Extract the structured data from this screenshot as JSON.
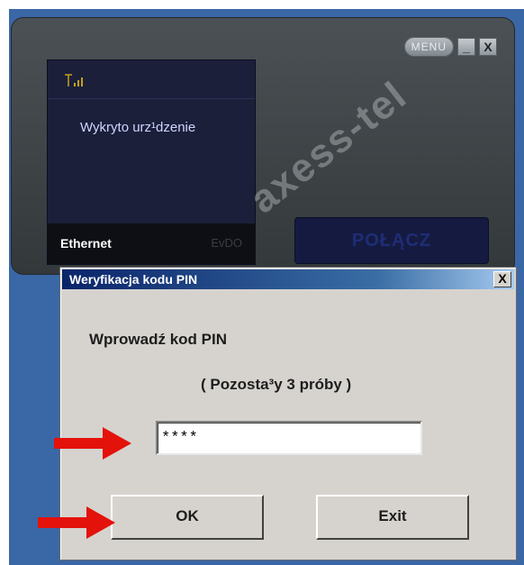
{
  "app": {
    "menu_label": "MENU",
    "minimize_label": "_",
    "close_label": "X",
    "signal_icon": "signal-bars-icon",
    "status_text": "Wykryto urz¹dzenie",
    "connection_type": "Ethernet",
    "network_mode": "EvDO",
    "connect_label": "POŁĄCZ",
    "watermark": "axess-tel"
  },
  "dialog": {
    "title": "Weryfikacja kodu PIN",
    "close_label": "X",
    "prompt": "Wprowadź kod PIN",
    "remaining": "( Pozosta³y 3 próby )",
    "pin_value": "****",
    "ok_label": "OK",
    "exit_label": "Exit"
  },
  "colors": {
    "arrow": "#e3120b",
    "titlebar": "#0a246a",
    "app_bg": "#3d4245"
  }
}
